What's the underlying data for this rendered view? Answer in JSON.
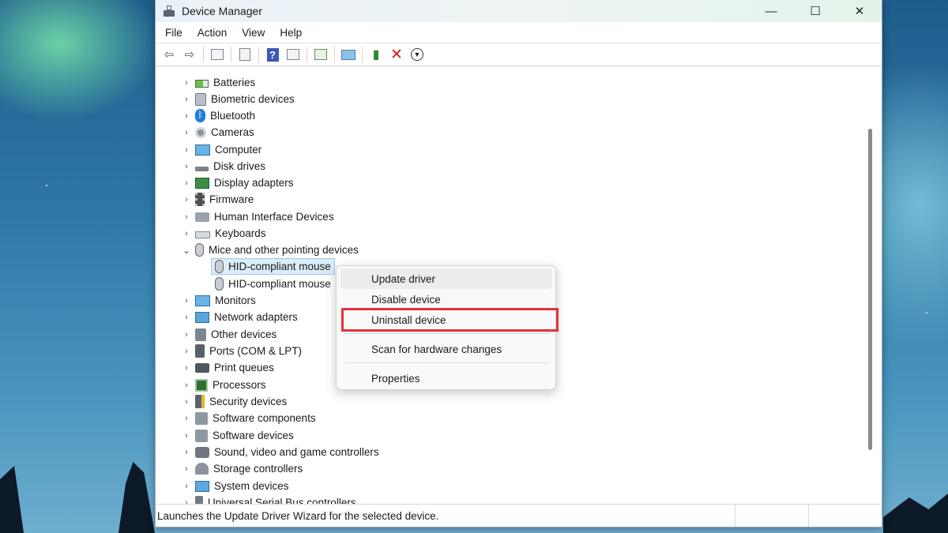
{
  "window": {
    "title": "Device Manager",
    "controls": {
      "minimize": "—",
      "maximize": "☐",
      "close": "✕"
    }
  },
  "menubar": [
    "File",
    "Action",
    "View",
    "Help"
  ],
  "toolbar": {
    "icons": [
      "back-arrow-icon",
      "forward-arrow-icon",
      "show-hide-console-tree-icon",
      "properties-sheet-icon",
      "help-icon",
      "action-pane-icon",
      "update-driver-icon",
      "scan-hardware-icon",
      "enable-device-icon",
      "uninstall-device-icon",
      "disable-device-icon"
    ],
    "help_glyph": "?"
  },
  "tree": {
    "collapsed_chevron": "›",
    "expanded_chevron": "⌄",
    "categories": [
      {
        "label": "Batteries",
        "icon": "battery-icon"
      },
      {
        "label": "Biometric devices",
        "icon": "biometric-icon"
      },
      {
        "label": "Bluetooth",
        "icon": "bluetooth-icon"
      },
      {
        "label": "Cameras",
        "icon": "camera-icon"
      },
      {
        "label": "Computer",
        "icon": "computer-icon"
      },
      {
        "label": "Disk drives",
        "icon": "disk-drive-icon"
      },
      {
        "label": "Display adapters",
        "icon": "display-adapter-icon"
      },
      {
        "label": "Firmware",
        "icon": "firmware-icon"
      },
      {
        "label": "Human Interface Devices",
        "icon": "hid-icon"
      },
      {
        "label": "Keyboards",
        "icon": "keyboard-icon"
      },
      {
        "label": "Mice and other pointing devices",
        "icon": "mouse-icon",
        "expanded": true
      },
      {
        "label": "Monitors",
        "icon": "monitor-icon"
      },
      {
        "label": "Network adapters",
        "icon": "network-adapter-icon"
      },
      {
        "label": "Other devices",
        "icon": "other-device-icon"
      },
      {
        "label": "Ports (COM & LPT)",
        "icon": "port-icon"
      },
      {
        "label": "Print queues",
        "icon": "printer-icon"
      },
      {
        "label": "Processors",
        "icon": "processor-icon"
      },
      {
        "label": "Security devices",
        "icon": "security-device-icon"
      },
      {
        "label": "Software components",
        "icon": "software-component-icon"
      },
      {
        "label": "Software devices",
        "icon": "software-device-icon"
      },
      {
        "label": "Sound, video and game controllers",
        "icon": "sound-icon"
      },
      {
        "label": "Storage controllers",
        "icon": "storage-controller-icon"
      },
      {
        "label": "System devices",
        "icon": "system-device-icon"
      },
      {
        "label": "Universal Serial Bus controllers",
        "icon": "usb-icon"
      }
    ],
    "mice_children": [
      {
        "label": "HID-compliant mouse",
        "selected": true
      },
      {
        "label": "HID-compliant mouse",
        "selected": false
      }
    ]
  },
  "context_menu": {
    "items": [
      {
        "label": "Update driver",
        "hovered": true
      },
      {
        "label": "Disable device"
      },
      {
        "label": "Uninstall device",
        "highlighted": true,
        "highlight_color": "#e53238"
      },
      {
        "label": "Scan for hardware changes"
      },
      {
        "label": "Properties"
      }
    ]
  },
  "statusbar": {
    "text": "Launches the Update Driver Wizard for the selected device."
  },
  "colors": {
    "highlight_border": "#e53238",
    "selection_bg": "#dbecfa",
    "selection_border": "#9ec7ea"
  }
}
